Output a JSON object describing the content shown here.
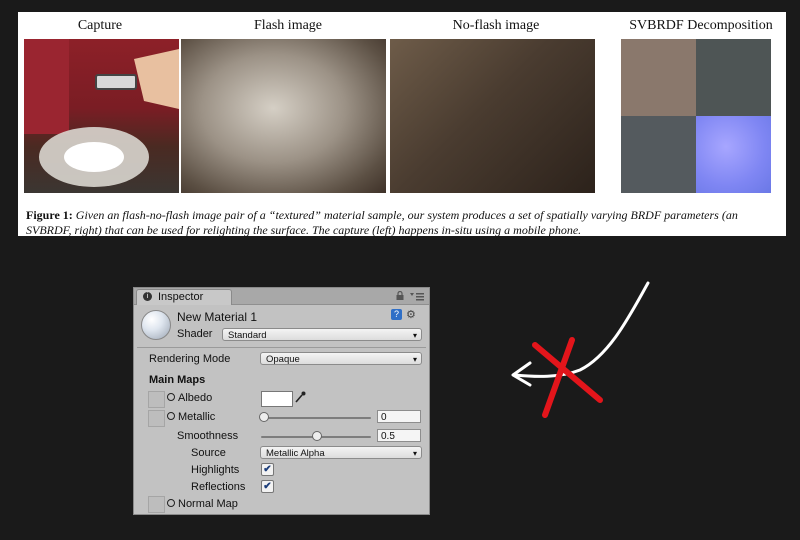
{
  "figure": {
    "panels": [
      {
        "title": "Capture"
      },
      {
        "title": "Flash image"
      },
      {
        "title": "No-flash image"
      },
      {
        "title": "SVBRDF Decomposition"
      }
    ],
    "caption_label": "Figure 1:",
    "caption_text": "Given an flash-no-flash image pair of a “textured” material sample, our system produces a set of spatially varying BRDF parameters (an SVBRDF, right) that can be used for relighting the surface. The capture (left) happens in-situ using a mobile phone."
  },
  "inspector": {
    "tab_label": "Inspector",
    "material_name": "New Material 1",
    "shader_label": "Shader",
    "shader_value": "Standard",
    "rendering_mode_label": "Rendering Mode",
    "rendering_mode_value": "Opaque",
    "main_maps_label": "Main Maps",
    "albedo_label": "Albedo",
    "metallic_label": "Metallic",
    "metallic_value": "0",
    "smoothness_label": "Smoothness",
    "smoothness_value": "0.5",
    "source_label": "Source",
    "source_value": "Metallic Alpha",
    "highlights_label": "Highlights",
    "highlights_checked": "✔",
    "reflections_label": "Reflections",
    "reflections_checked": "✔",
    "normal_map_label": "Normal Map",
    "help_icon": "?"
  },
  "annotations": {
    "arrow_color": "#ffffff",
    "cross_color": "#e3151b"
  }
}
